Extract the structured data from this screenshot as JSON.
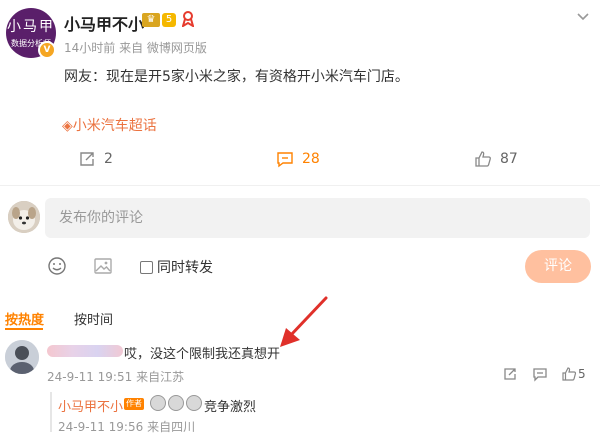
{
  "post": {
    "author": {
      "name": "小马甲不小",
      "avatar_line1": "小马甲",
      "avatar_line2": "数据分析师",
      "verified_badge": "V",
      "crown_icon": "crown-icon",
      "level": "5"
    },
    "meta": "14小时前 来自 微博网页版",
    "content": "网友：现在是开5家小米之家，有资格开小米汽车门店。",
    "topic": "小米汽车超话",
    "actions": {
      "share_count": "2",
      "comment_count": "28",
      "like_count": "87"
    }
  },
  "composer": {
    "placeholder": "发布你的评论",
    "repost_label": "同时转发",
    "submit_label": "评论"
  },
  "sort_tabs": {
    "hot": "按热度",
    "time": "按时间"
  },
  "comment": {
    "text": "哎，没这个限制我还真想开",
    "time": "24-9-11 19:51",
    "location": "来自江苏",
    "like_count": "5"
  },
  "reply": {
    "author": "小马甲不小",
    "author_tag": "作者",
    "text": "竞争激烈",
    "time": "24-9-11 19:56",
    "location": "来自四川"
  },
  "colors": {
    "accent": "#ff8200",
    "link": "#eb7340",
    "annotation_arrow": "#e0302a"
  }
}
